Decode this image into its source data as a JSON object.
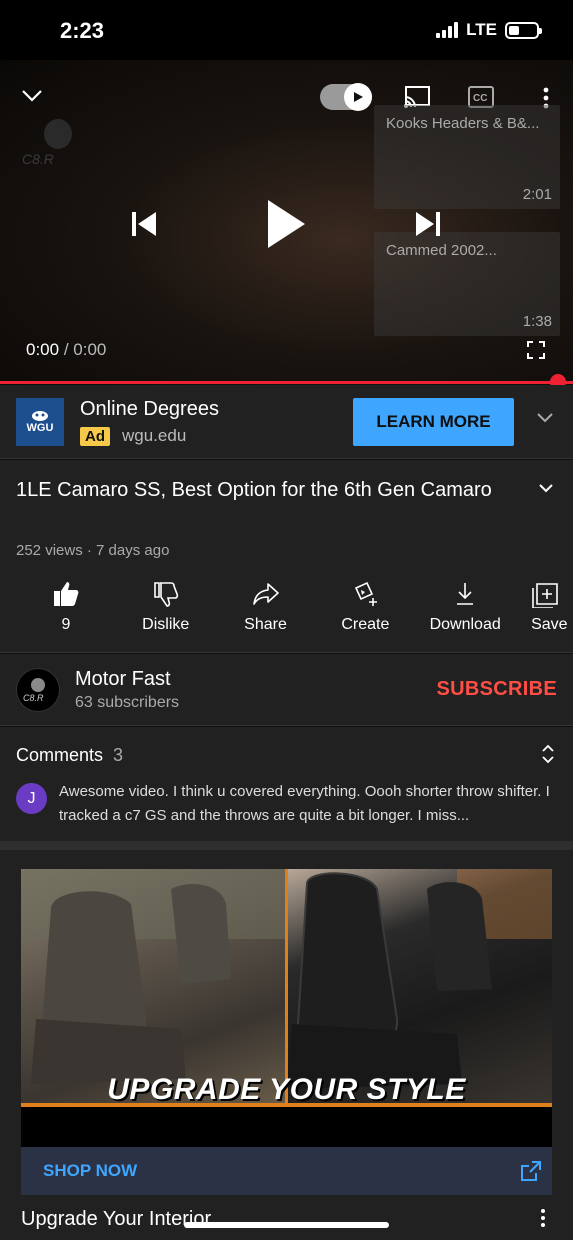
{
  "status": {
    "time": "2:23",
    "network": "LTE"
  },
  "player": {
    "current_time": "0:00",
    "separator": "/",
    "total_time": "0:00",
    "end_cards": [
      {
        "title": "Kooks Headers & B&...",
        "duration": "2:01"
      },
      {
        "title": "Cammed 2002...",
        "duration": "1:38"
      }
    ],
    "progress_percent": 100
  },
  "ad": {
    "logo_text": "WGU",
    "title": "Online Degrees",
    "badge": "Ad",
    "domain": "wgu.edu",
    "cta": "LEARN MORE"
  },
  "video": {
    "title": "1LE Camaro SS, Best Option for the 6th Gen Camaro",
    "meta": "252 views · 7 days ago",
    "actions": [
      {
        "label": "9",
        "icon": "thumbs-up-icon"
      },
      {
        "label": "Dislike",
        "icon": "thumbs-down-icon"
      },
      {
        "label": "Share",
        "icon": "share-icon"
      },
      {
        "label": "Create",
        "icon": "create-icon"
      },
      {
        "label": "Download",
        "icon": "download-icon"
      },
      {
        "label": "Save",
        "icon": "save-icon"
      }
    ]
  },
  "channel": {
    "name": "Motor Fast",
    "subscribers": "63 subscribers",
    "subscribe_label": "SUBSCRIBE"
  },
  "comments": {
    "header": "Comments",
    "count": "3",
    "avatar_letter": "J",
    "top_comment": "Awesome video.  I think u covered everything. Oooh shorter throw shifter. I tracked a c7 GS and the throws are quite a bit longer. I miss..."
  },
  "promo": {
    "banner_text": "UPGRADE YOUR STYLE",
    "shop_label": "SHOP NOW",
    "title": "Upgrade Your Interior"
  },
  "colors": {
    "accent_red": "#ff4e45",
    "link_blue": "#3ea6ff",
    "ad_badge": "#f7c948"
  }
}
